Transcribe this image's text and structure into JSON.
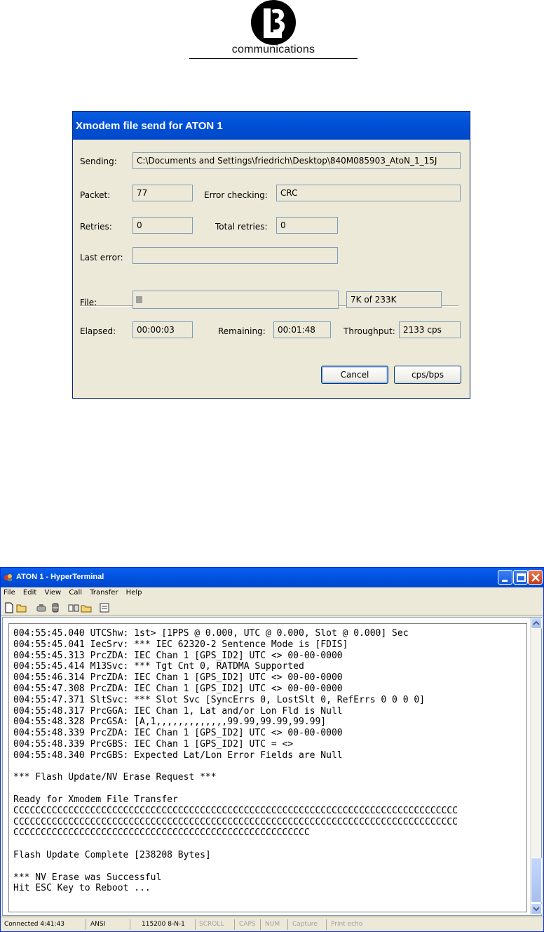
{
  "logo": {
    "text": "communications",
    "mark": "L3"
  },
  "dialog": {
    "title": "Xmodem file send for ATON 1",
    "sending_label": "Sending:",
    "sending_value": "C:\\Documents and Settings\\friedrich\\Desktop\\840M085903_AtoN_1_15J",
    "packet_label": "Packet:",
    "packet_value": "77",
    "error_checking_label": "Error checking:",
    "error_checking_value": "CRC",
    "retries_label": "Retries:",
    "retries_value": "0",
    "total_retries_label": "Total retries:",
    "total_retries_value": "0",
    "last_error_label": "Last error:",
    "last_error_value": "",
    "file_label": "File:",
    "file_progress": 0.03,
    "file_size_value": "7K of 233K",
    "elapsed_label": "Elapsed:",
    "elapsed_value": "00:00:03",
    "remaining_label": "Remaining:",
    "remaining_value": "00:01:48",
    "throughput_label": "Throughput:",
    "throughput_value": "2133 cps",
    "cancel_label": "Cancel",
    "cpsbps_label": "cps/bps"
  },
  "hyperterminal": {
    "title": "ATON 1 - HyperTerminal",
    "menu": [
      "File",
      "Edit",
      "View",
      "Call",
      "Transfer",
      "Help"
    ],
    "toolbar_icons": [
      "new-icon",
      "open-icon",
      "connect-icon",
      "disconnect-icon",
      "send-icon",
      "receive-icon",
      "properties-icon"
    ],
    "terminal_lines": [
      "004:55:45.040 UTCShw: 1st> [1PPS @ 0.000, UTC @ 0.000, Slot @ 0.000] Sec",
      "004:55:45.041 IecSrv: *** IEC 62320-2 Sentence Mode is [FDIS]",
      "004:55:45.313 PrcZDA: IEC Chan 1 [GPS_ID2] UTC <> 00-00-0000",
      "004:55:45.414 M13Svc: *** Tgt Cnt 0, RATDMA Supported",
      "004:55:46.314 PrcZDA: IEC Chan 1 [GPS_ID2] UTC <> 00-00-0000",
      "004:55:47.308 PrcZDA: IEC Chan 1 [GPS_ID2] UTC <> 00-00-0000",
      "004:55:47.371 SltSvc: *** Slot Svc [SyncErrs 0, LostSlt 0, RefErrs 0 0 0 0]",
      "004:55:48.317 PrcGGA: IEC Chan 1, Lat and/or Lon Fld is Null",
      "004:55:48.328 PrcGSA: [A,1,,,,,,,,,,,,,99.99,99.99,99.99]",
      "004:55:48.339 PrcZDA: IEC Chan 1 [GPS_ID2] UTC <> 00-00-0000",
      "004:55:48.339 PrcGBS: IEC Chan 1 [GPS_ID2] UTC = <>",
      "004:55:48.340 PrcGBS: Expected Lat/Lon Error Fields are Null",
      "",
      "*** Flash Update/NV Erase Request ***",
      "",
      "Ready for Xmodem File Transfer",
      "CCCCCCCCCCCCCCCCCCCCCCCCCCCCCCCCCCCCCCCCCCCCCCCCCCCCCCCCCCCCCCCCCCCCCCCCCCCCCCCCC",
      "CCCCCCCCCCCCCCCCCCCCCCCCCCCCCCCCCCCCCCCCCCCCCCCCCCCCCCCCCCCCCCCCCCCCCCCCCCCCCCCCC",
      "CCCCCCCCCCCCCCCCCCCCCCCCCCCCCCCCCCCCCCCCCCCCCCCCCCCCCC",
      "",
      "Flash Update Complete [238208 Bytes]",
      "",
      "*** NV Erase was Successful",
      "Hit ESC Key to Reboot ..."
    ],
    "status": {
      "connected": "Connected 4:41:43",
      "emulation": "ANSI",
      "settings": "115200 8-N-1",
      "scroll": "SCROLL",
      "caps": "CAPS",
      "num": "NUM",
      "capture": "Capture",
      "print_echo": "Print echo"
    }
  }
}
